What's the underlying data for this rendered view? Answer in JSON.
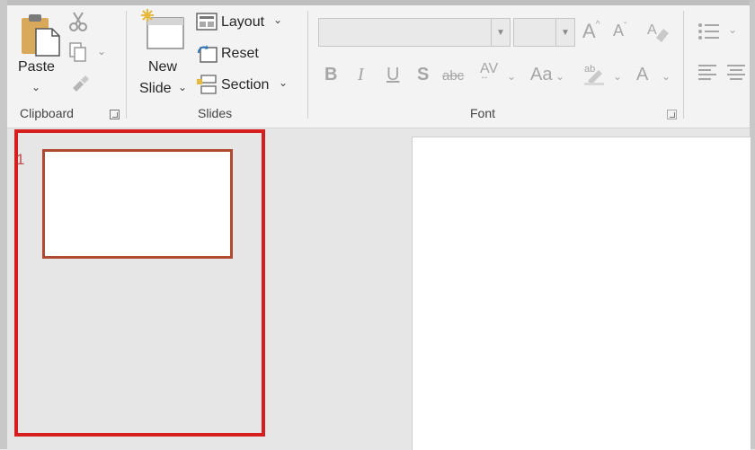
{
  "clipboard": {
    "paste_label": "Paste",
    "group_label": "Clipboard"
  },
  "slides_group": {
    "new_slide_line1": "New",
    "new_slide_line2": "Slide",
    "layout_label": "Layout",
    "reset_label": "Reset",
    "section_label": "Section",
    "group_label": "Slides"
  },
  "font_group": {
    "group_label": "Font",
    "font_name_value": "",
    "font_size_value": ""
  },
  "thumbnails": {
    "slide_number": "1"
  },
  "colors": {
    "highlight_border": "#d71e1e",
    "thumb_border": "#b04a31",
    "ribbon_bg": "#f3f3f3"
  }
}
